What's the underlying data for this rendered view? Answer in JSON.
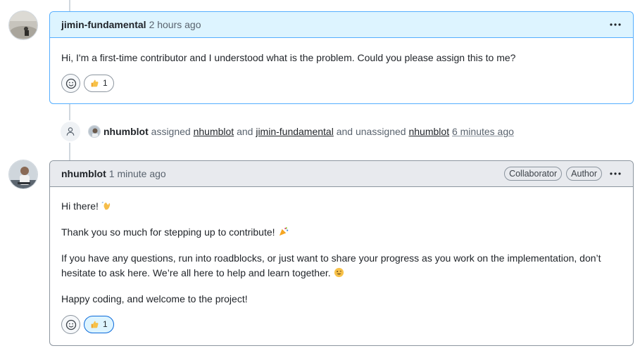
{
  "comment1": {
    "author": "jimin-fundamental",
    "timestamp": "2 hours ago",
    "body": "Hi, I'm a first-time contributor and I understood what is the problem. Could you please assign this to me?",
    "reaction_count": "1"
  },
  "event": {
    "actor": "nhumblot",
    "verb_assigned": "assigned",
    "assignee1": "nhumblot",
    "and1": "and",
    "assignee2": "jimin-fundamental",
    "and_unassigned": "and unassigned",
    "unassignee": "nhumblot",
    "timestamp": "6 minutes ago"
  },
  "comment2": {
    "author": "nhumblot",
    "timestamp": "1 minute ago",
    "badges": [
      "Collaborator",
      "Author"
    ],
    "paragraphs": [
      "Hi there!",
      "Thank you so much for stepping up to contribute!",
      "If you have any questions, run into roadblocks, or just want to share your progress as you work on the implementation, don’t hesitate to ask here. We’re all here to help and learn together.",
      "Happy coding, and welcome to the project!"
    ],
    "reaction_count": "1"
  },
  "colors": {
    "highlight_header": "#ddf4ff",
    "highlight_border": "#54aeff",
    "header_gray": "#e8eaee",
    "border_gray": "#8c959f"
  },
  "icons": [
    "kebab-icon",
    "smiley-icon",
    "thumbs-up-icon",
    "person-icon",
    "wave-emoji",
    "party-emoji",
    "smile-emoji"
  ]
}
